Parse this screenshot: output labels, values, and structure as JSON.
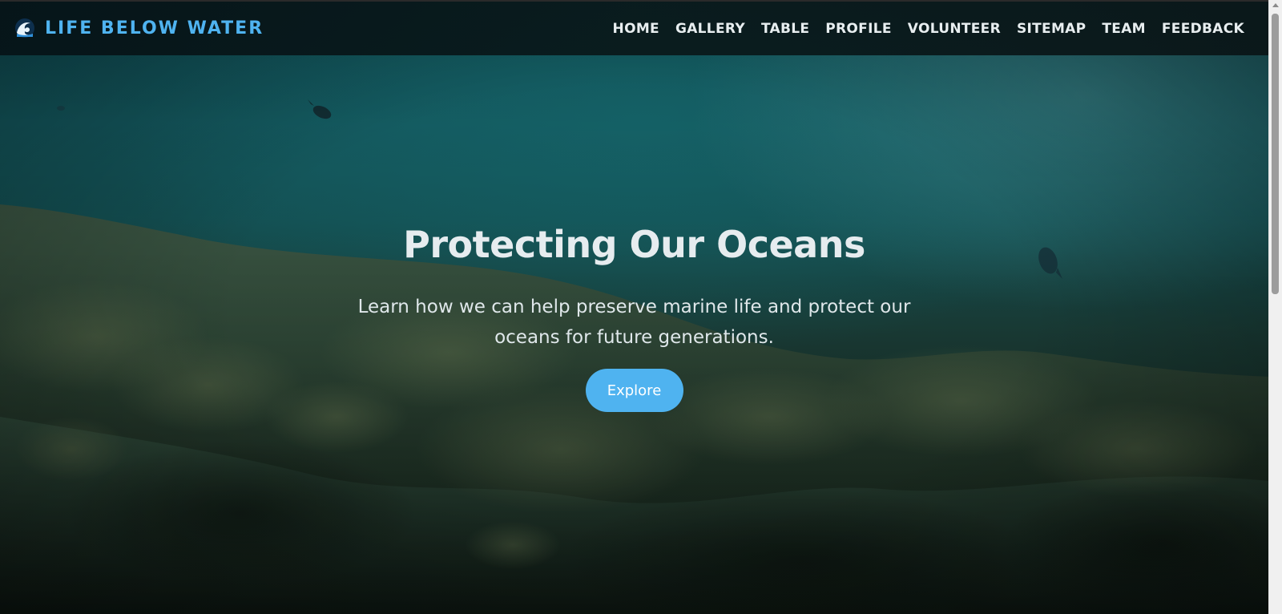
{
  "brand": {
    "title": "LIFE BELOW WATER",
    "icon": "wave-icon",
    "accent_color": "#4fb3f0"
  },
  "nav": {
    "items": [
      {
        "label": "HOME"
      },
      {
        "label": "GALLERY"
      },
      {
        "label": "TABLE"
      },
      {
        "label": "PROFILE"
      },
      {
        "label": "VOLUNTEER"
      },
      {
        "label": "SITEMAP"
      },
      {
        "label": "TEAM"
      },
      {
        "label": "FEEDBACK"
      }
    ]
  },
  "hero": {
    "title": "Protecting Our Oceans",
    "subtitle": "Learn how we can help preserve marine life and protect our oceans for future generations.",
    "button_label": "Explore",
    "button_color": "#4fb3f0"
  }
}
